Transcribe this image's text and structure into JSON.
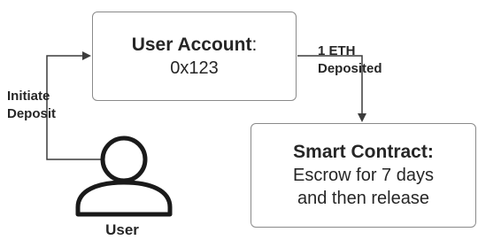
{
  "nodes": {
    "account": {
      "title": "User Account",
      "title_suffix": ":",
      "value": "0x123"
    },
    "contract": {
      "title": "Smart Contract:",
      "lines": [
        "Escrow for 7 days",
        "and then release"
      ]
    },
    "user": {
      "label": "User",
      "icon": "person-icon"
    }
  },
  "edges": {
    "deposit": {
      "label_lines": [
        "Initiate",
        "Deposit"
      ]
    },
    "eth": {
      "label_lines": [
        "1 ETH",
        "Deposited"
      ]
    }
  },
  "colors": {
    "stroke": "#3c3c3c",
    "box_border": "#8a8a8a",
    "text": "#262626"
  }
}
